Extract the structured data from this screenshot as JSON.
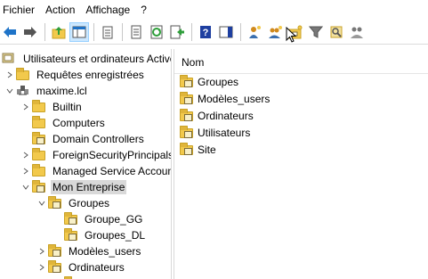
{
  "menu": [
    "Fichier",
    "Action",
    "Affichage",
    "?"
  ],
  "toolbar": {
    "buttons": [
      {
        "name": "back-icon",
        "color": "#1e73c8"
      },
      {
        "name": "forward-icon",
        "color": "#555555"
      },
      {
        "name": "up-folder-icon",
        "color": "#2e9e3a"
      },
      {
        "name": "console-tree-icon",
        "color": "#1e73c8",
        "active": true
      },
      {
        "name": "copy-icon",
        "color": "#555555"
      },
      {
        "name": "properties-icon",
        "color": "#555555"
      },
      {
        "name": "refresh-icon",
        "color": "#2e9e3a"
      },
      {
        "name": "export-list-icon",
        "color": "#2e9e3a"
      },
      {
        "name": "help-icon",
        "color": "#1e3fa0"
      },
      {
        "name": "action-pane-icon",
        "color": "#1e3fa0"
      },
      {
        "name": "new-user-icon",
        "color": "#d08a1e"
      },
      {
        "name": "new-group-icon",
        "color": "#d08a1e"
      },
      {
        "name": "new-ou-icon",
        "color": "#d0a21e"
      },
      {
        "name": "filter-icon",
        "color": "#555555"
      },
      {
        "name": "find-icon",
        "color": "#d0a21e"
      },
      {
        "name": "add-to-group-icon",
        "color": "#555555"
      }
    ]
  },
  "tree": {
    "root_label": "Utilisateurs et ordinateurs Active Directory",
    "saved_queries_label": "Requêtes enregistrées",
    "domain_label": "maxime.lcl",
    "builtin_label": "Builtin",
    "computers_label": "Computers",
    "domain_controllers_label": "Domain Controllers",
    "foreign_label": "ForeignSecurityPrincipals",
    "msa_label": "Managed Service Accounts",
    "mon_entreprise_label": "Mon Entreprise",
    "groupes_label": "Groupes",
    "groupe_gg_label": "Groupe_GG",
    "groupes_dl_label": "Groupes_DL",
    "modeles_label": "Modèles_users",
    "ordinateurs_label": "Ordinateurs"
  },
  "list": {
    "column_header": "Nom",
    "items": [
      "Groupes",
      "Modèles_users",
      "Ordinateurs",
      "Utilisateurs",
      "Site"
    ]
  }
}
